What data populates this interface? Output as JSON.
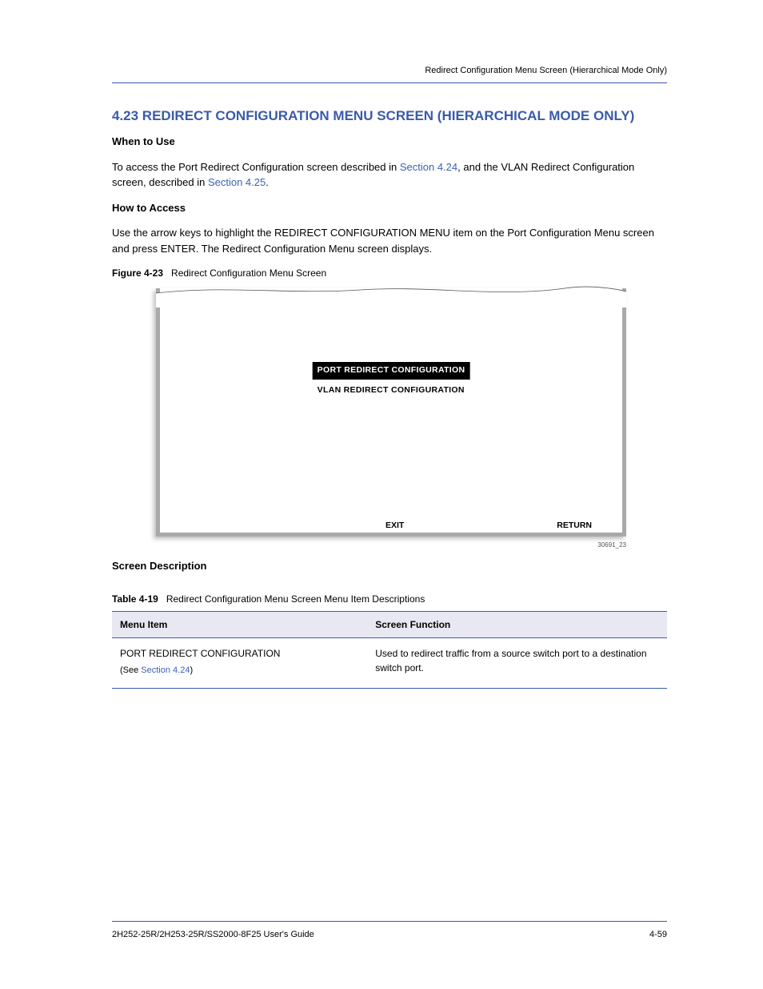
{
  "header": {
    "section_label": "Redirect Configuration Menu Screen (Hierarchical Mode Only)"
  },
  "section1": {
    "title": "4.23 REDIRECT CONFIGURATION MENU SCREEN (HIERARCHICAL MODE ONLY)",
    "intro": "When to Use",
    "p1_a": "To access the Port Redirect Configuration screen described in ",
    "p1_link1": "Section 4.24",
    "p1_b": ", and the VLAN Redirect Configuration screen, described in ",
    "p1_link2": "Section 4.25",
    "p1_c": ".",
    "how_title": "How to Access",
    "how_text": "Use the arrow keys to highlight the REDIRECT CONFIGURATION MENU item on the Port Configuration Menu screen and press ENTER. The Redirect Configuration Menu screen displays."
  },
  "figure": {
    "number": "Figure 4-23",
    "title": "Redirect Configuration Menu Screen",
    "menu_item_selected": "PORT REDIRECT CONFIGURATION",
    "menu_item_2": "VLAN REDIRECT CONFIGURATION",
    "exit": "EXIT",
    "ret": "RETURN",
    "imgid": "30691_23"
  },
  "table": {
    "number": "Table 4-19",
    "title": "Redirect Configuration Menu Screen Menu Item Descriptions",
    "header_a": "Menu Item",
    "header_b": "Screen Function",
    "row1_a": "PORT REDIRECT CONFIGURATION",
    "row1_a_note_a": "(See ",
    "row1_a_note_link": "Section 4.24",
    "row1_a_note_b": ")",
    "row1_b": "Used to redirect traffic from a source switch port to a destination switch port."
  },
  "screen_desc": "Screen Description",
  "footer": {
    "left": "2H252-25R/2H253-25R/SS2000-8F25 User's Guide",
    "right": "4-59"
  }
}
